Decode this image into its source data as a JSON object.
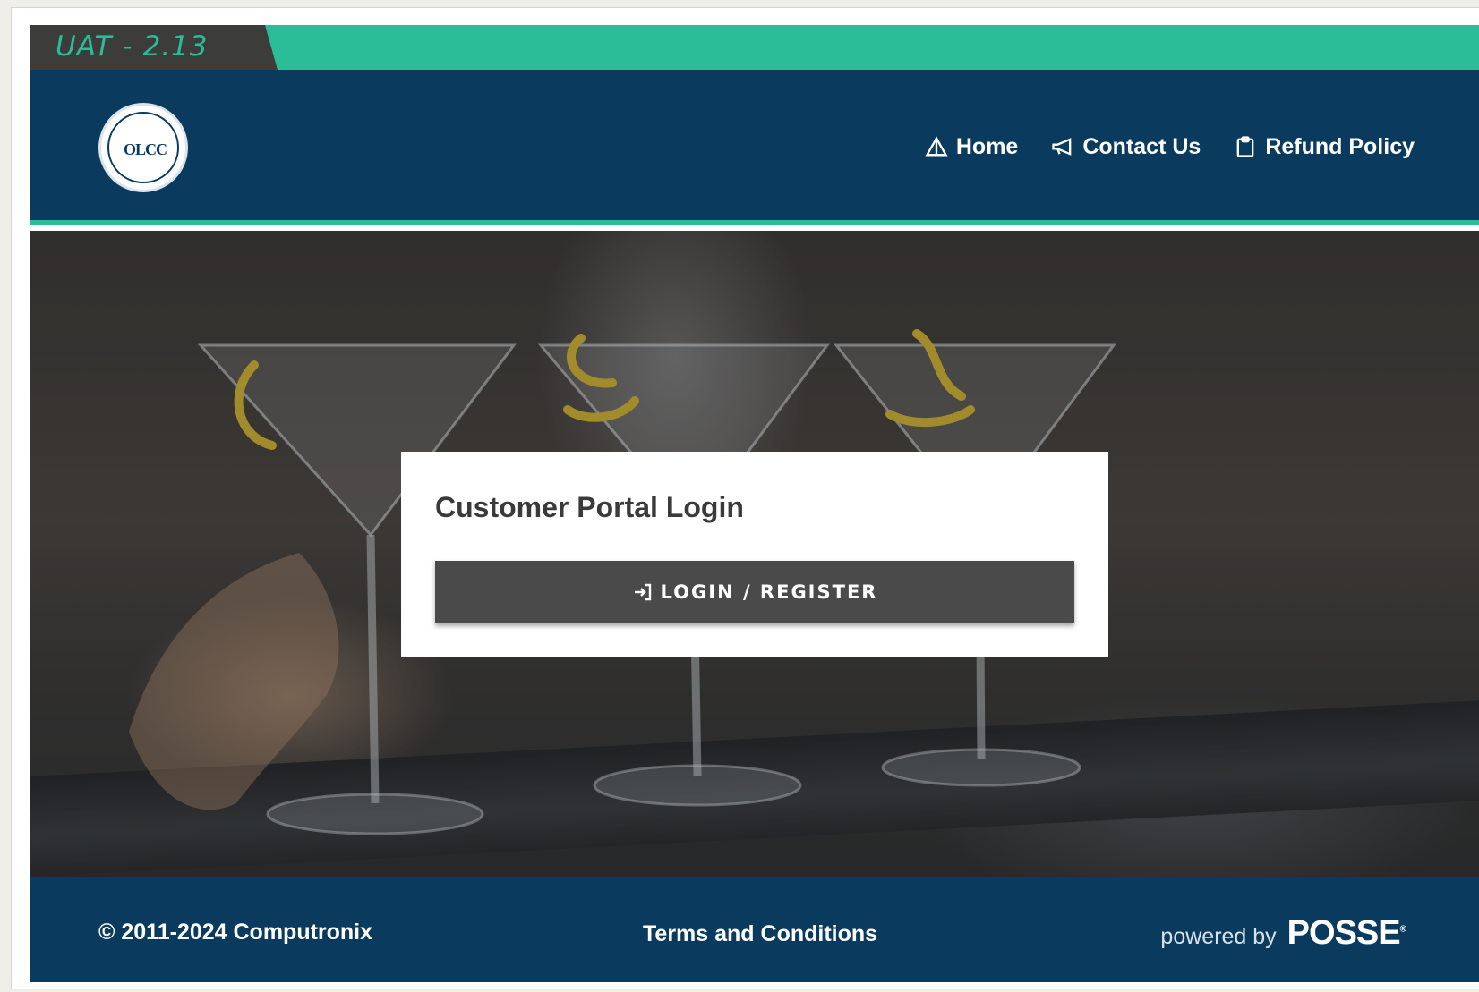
{
  "environment": {
    "label": "UAT - 2.13"
  },
  "header": {
    "logo_text": "OLCC",
    "nav": [
      {
        "label": "Home",
        "icon": "home-icon"
      },
      {
        "label": "Contact Us",
        "icon": "megaphone-icon"
      },
      {
        "label": "Refund Policy",
        "icon": "clipboard-icon"
      }
    ]
  },
  "login": {
    "title": "Customer Portal Login",
    "button_label": "LOGIN / REGISTER",
    "button_icon": "sign-in-icon"
  },
  "footer": {
    "copyright": "© 2011-2024 Computronix",
    "terms": "Terms and Conditions",
    "powered_by": "powered by",
    "brand": "POSSE"
  },
  "colors": {
    "header_bg": "#0a3b5e",
    "accent": "#2bbd98",
    "button_bg": "#4a4a4a"
  }
}
